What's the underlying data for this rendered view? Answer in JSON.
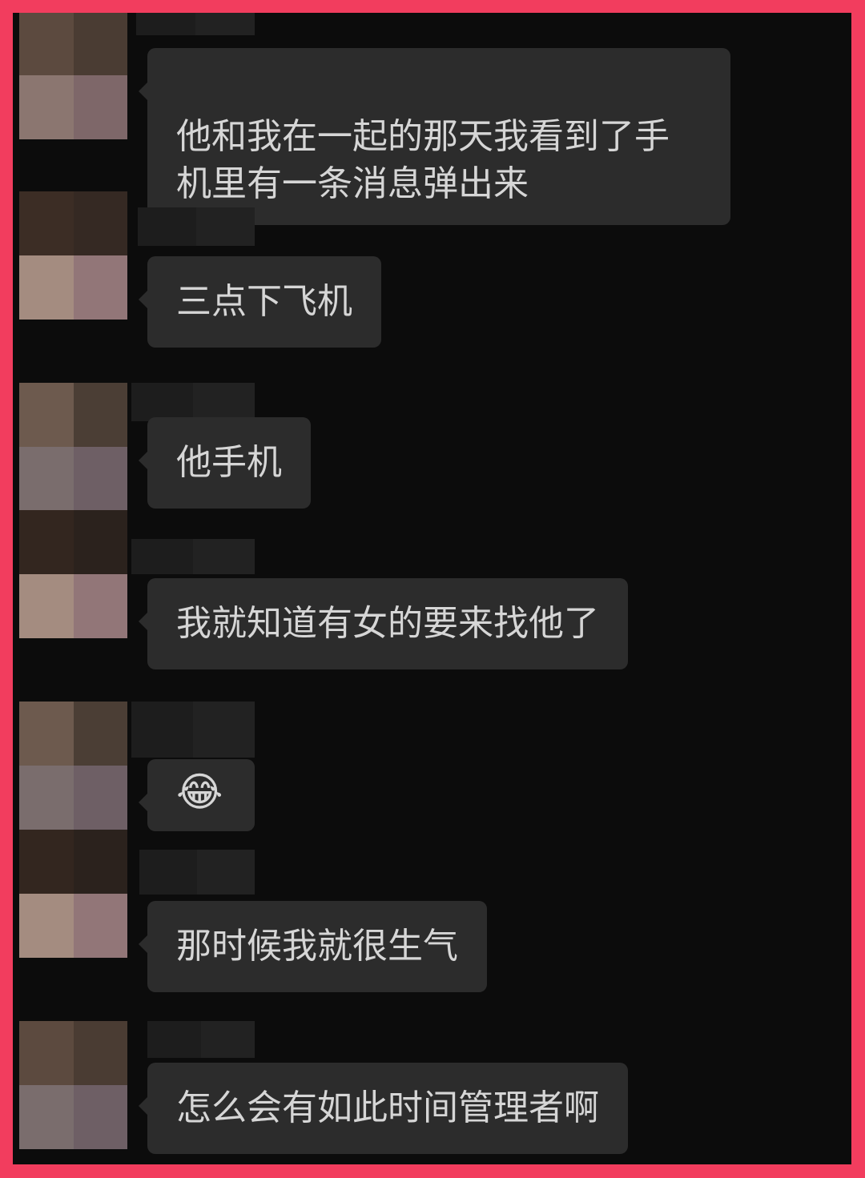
{
  "messages": [
    {
      "text": "他和我在一起的那天我看到了手\n机里有一条消息弹出来"
    },
    {
      "text": "三点下飞机"
    },
    {
      "text": "他手机"
    },
    {
      "text": "我就知道有女的要来找他了"
    },
    {
      "emoji": "😂"
    },
    {
      "text": "那时候我就很生气"
    },
    {
      "text": "怎么会有如此时间管理者啊"
    }
  ],
  "colors": {
    "frame_border": "#f23d5e",
    "background": "#0c0c0c",
    "bubble": "#2c2c2c",
    "text": "#d6d6d6"
  },
  "icons": {
    "avatar": "pixelated-avatar",
    "emoji": "tears-of-joy-emoji"
  }
}
